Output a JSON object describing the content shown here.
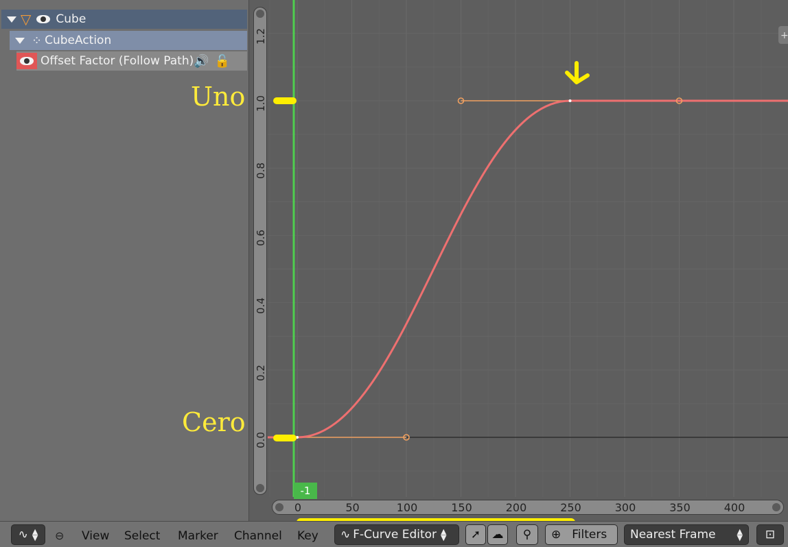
{
  "channels": {
    "object_name": "Cube",
    "action_name": "CubeAction",
    "fcurve_name": "Offset Factor (Follow Path)",
    "fcurve_color": "#e05656"
  },
  "graph": {
    "current_frame": "-1",
    "y_ticks": [
      "0.0",
      "0.2",
      "0.4",
      "0.6",
      "0.8",
      "1.0",
      "1.2"
    ],
    "x_ticks": [
      "0",
      "50",
      "100",
      "150",
      "200",
      "250",
      "300",
      "350",
      "400"
    ],
    "curve_color": "#ee7070",
    "handle_color": "#f0a060",
    "keyframes": [
      {
        "frame": 0,
        "value": 0.0
      },
      {
        "frame": 250,
        "value": 1.0
      }
    ],
    "handles": [
      {
        "frame": 100,
        "value": 0.0
      },
      {
        "frame": 150,
        "value": 1.0
      },
      {
        "frame": 350,
        "value": 1.0
      }
    ]
  },
  "annotations": {
    "uno": "Uno",
    "cero": "Cero",
    "color": "#ffeb3b"
  },
  "header": {
    "menus": [
      "View",
      "Select",
      "Marker",
      "Channel",
      "Key"
    ],
    "mode": "F-Curve Editor",
    "filters": "Filters",
    "snap": "Nearest Frame"
  }
}
